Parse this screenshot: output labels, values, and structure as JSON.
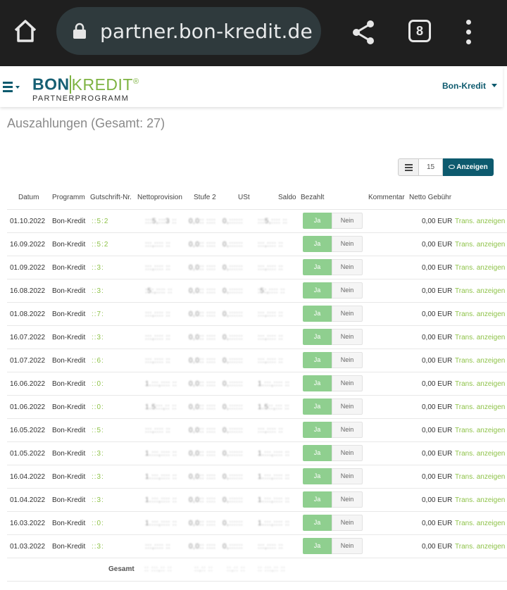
{
  "browser": {
    "url": "partner.bon-kredit.de",
    "tab_count": "8"
  },
  "header": {
    "logo_left": "BON",
    "logo_right": "KREDIT",
    "logo_reg": "®",
    "logo_sub": "PARTNERPROGRAMM",
    "account_label": "Bon-Kredit"
  },
  "page": {
    "title": "Auszahlungen (Gesamt: 27)"
  },
  "toolbar": {
    "per_page": "15",
    "show_label": "Anzeigen"
  },
  "table": {
    "columns": {
      "datum": "Datum",
      "programm": "Programm",
      "gutschrift": "Gutschrift-Nr.",
      "netto": "Nettoprovision",
      "stufe2": "Stufe 2",
      "ust": "USt",
      "saldo": "Saldo",
      "bezahlt": "Bezahlt",
      "kommentar": "Kommentar",
      "gebuehr": "Netto Gebühr"
    },
    "ja_label": "Ja",
    "nein_label": "Nein",
    "link_label": "Trans. anzeigen",
    "rows": [
      {
        "date": "01.10.2022",
        "program": "Bon-Kredit",
        "nr": "::5:2",
        "netto": ":::5,:::3 ::",
        "stufe": "0,0:: ::::",
        "ust": "0,::::::",
        "saldo": ":::5,:::: ::",
        "fee": "0,00 EUR"
      },
      {
        "date": "16.09.2022",
        "program": "Bon-Kredit",
        "nr": "::5:2",
        "netto": ":::,:::: ::",
        "stufe": "0,0:: ::::",
        "ust": "0,::::::",
        "saldo": ":::,:::: ::",
        "fee": "0,00 EUR"
      },
      {
        "date": "01.09.2022",
        "program": "Bon-Kredit",
        "nr": "::3:",
        "netto": ":::,:::: ::",
        "stufe": "0,0:: ::::",
        "ust": "0,::::::",
        "saldo": ":::,:::: ::",
        "fee": "0,00 EUR"
      },
      {
        "date": "16.08.2022",
        "program": "Bon-Kredit",
        "nr": "::3:",
        "netto": ":5:,:::: ::",
        "stufe": "0,0:: ::::",
        "ust": "0,::::::",
        "saldo": ":5:,:::: ::",
        "fee": "0,00 EUR"
      },
      {
        "date": "01.08.2022",
        "program": "Bon-Kredit",
        "nr": "::7:",
        "netto": ":::,:::: ::",
        "stufe": "0,0:: ::::",
        "ust": "0,::::::",
        "saldo": ":::,:::: ::",
        "fee": "0,00 EUR"
      },
      {
        "date": "16.07.2022",
        "program": "Bon-Kredit",
        "nr": "::3:",
        "netto": ":::,:::: ::",
        "stufe": "0,0:: ::::",
        "ust": "0,::::::",
        "saldo": ":::,:::: ::",
        "fee": "0,00 EUR"
      },
      {
        "date": "01.07.2022",
        "program": "Bon-Kredit",
        "nr": "::6:",
        "netto": ":::,:::: ::",
        "stufe": "0,0:: ::::",
        "ust": "0,::::::",
        "saldo": ":::,:::: ::",
        "fee": "0,00 EUR"
      },
      {
        "date": "16.06.2022",
        "program": "Bon-Kredit",
        "nr": "::0:",
        "netto": "1.:::,:::: ::",
        "stufe": "0,0:: ::::",
        "ust": "0,::::::",
        "saldo": "1.:::,:::: ::",
        "fee": "0,00 EUR"
      },
      {
        "date": "01.06.2022",
        "program": "Bon-Kredit",
        "nr": "::0:",
        "netto": "1.5:::,:: ::",
        "stufe": "0,0:: ::::",
        "ust": "0,::::::",
        "saldo": "1.5::,::: ::",
        "fee": "0,00 EUR"
      },
      {
        "date": "16.05.2022",
        "program": "Bon-Kredit",
        "nr": "::5:",
        "netto": ":::,:::: ::",
        "stufe": "0,0:: ::::",
        "ust": "0,::::::",
        "saldo": ":::,:::: ::",
        "fee": "0,00 EUR"
      },
      {
        "date": "01.05.2022",
        "program": "Bon-Kredit",
        "nr": "::3:",
        "netto": "1.:::,:::: ::",
        "stufe": "0,0:: ::::",
        "ust": "0,::::::",
        "saldo": "1.:::,:::: ::",
        "fee": "0,00 EUR"
      },
      {
        "date": "16.04.2022",
        "program": "Bon-Kredit",
        "nr": "::3:",
        "netto": "1.:::,:::: ::",
        "stufe": "0,0:: ::::",
        "ust": "0,::::::",
        "saldo": "1.:::,:::: ::",
        "fee": "0,00 EUR"
      },
      {
        "date": "01.04.2022",
        "program": "Bon-Kredit",
        "nr": "::3:",
        "netto": "1.:::,:::: ::",
        "stufe": "0,0:: ::::",
        "ust": "0,::::::",
        "saldo": "1.:::,:::: ::",
        "fee": "0,00 EUR"
      },
      {
        "date": "16.03.2022",
        "program": "Bon-Kredit",
        "nr": "::0:",
        "netto": "1.:::,:::: ::",
        "stufe": "0,0:: ::::",
        "ust": "0,::::::",
        "saldo": "1.:::,:::: ::",
        "fee": "0,00 EUR"
      },
      {
        "date": "01.03.2022",
        "program": "Bon-Kredit",
        "nr": "::3:",
        "netto": ":::,:::: ::",
        "stufe": "0,0:: ::::",
        "ust": "0,::::::",
        "saldo": ":::,:::: ::",
        "fee": "0,00 EUR"
      }
    ],
    "totals": {
      "label": "Gesamt",
      "netto": ":: :::,:: ::",
      "stufe": "::,:: ::",
      "ust": "::,:: ::",
      "saldo": ":: :::,:: ::"
    }
  }
}
